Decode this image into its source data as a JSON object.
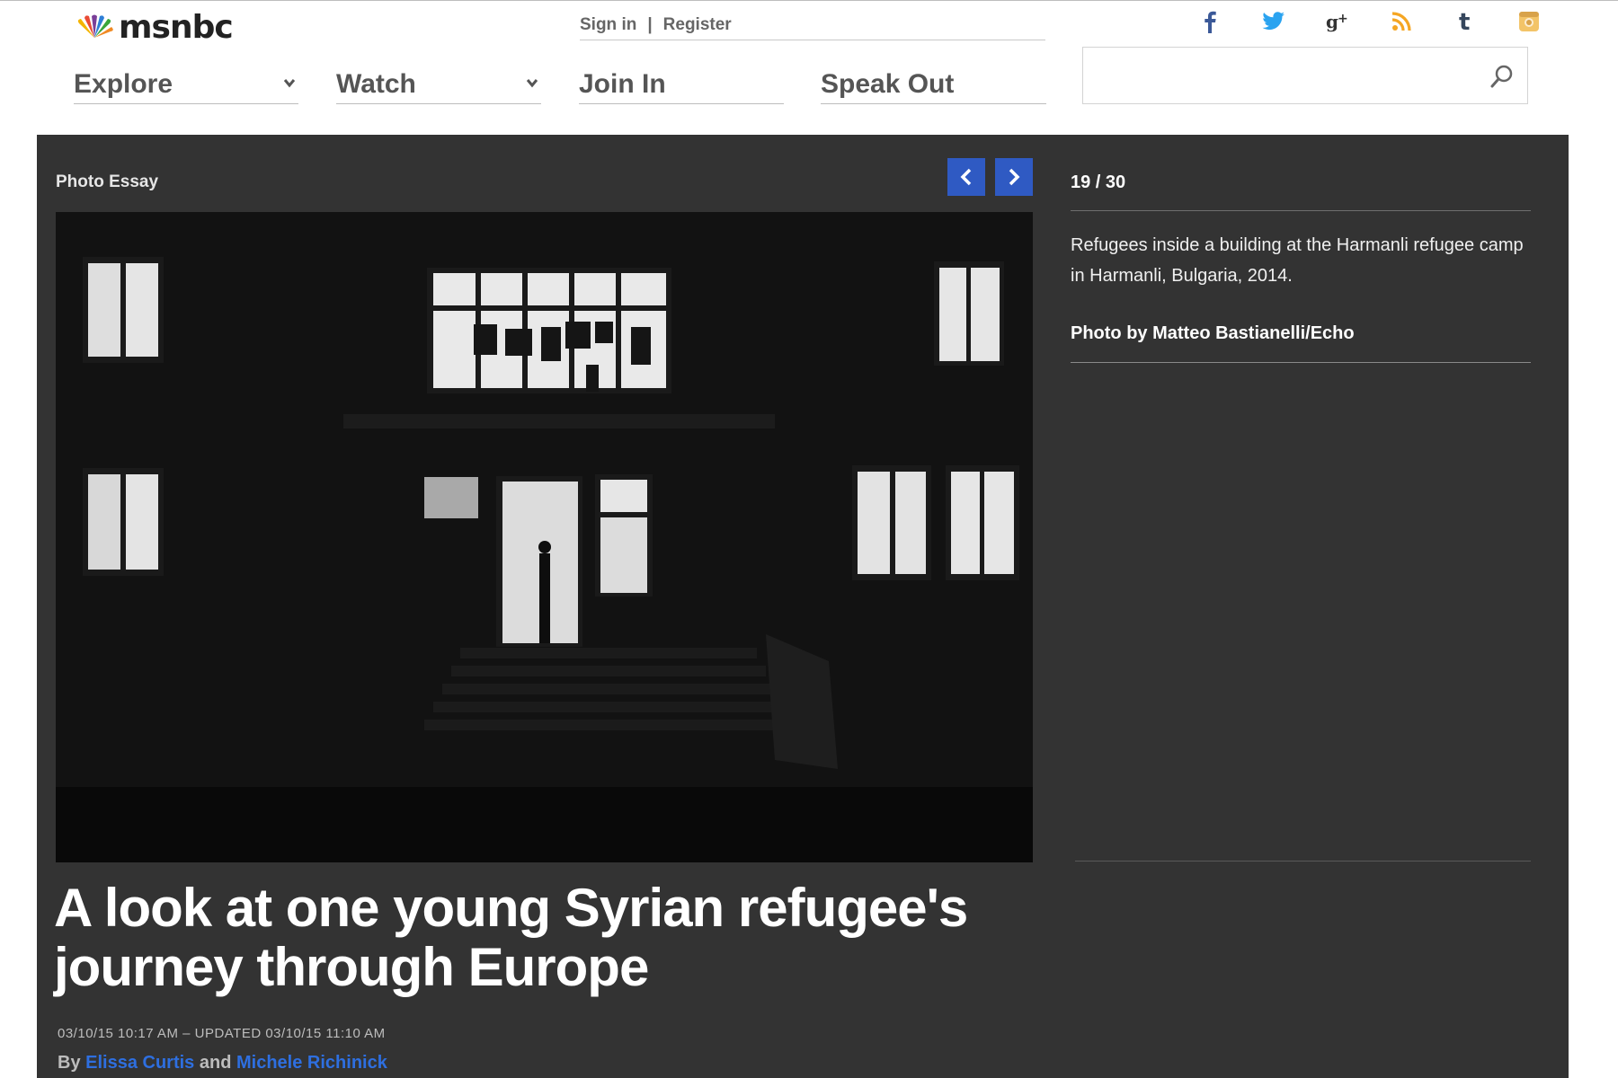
{
  "brand": {
    "name": "msnbc"
  },
  "account": {
    "sign_in": "Sign in",
    "separator": "|",
    "register": "Register"
  },
  "social": [
    {
      "icon": "facebook-icon",
      "glyph": "f",
      "color": "#3b5998"
    },
    {
      "icon": "twitter-icon",
      "glyph": "t",
      "color": "#2aa3f0"
    },
    {
      "icon": "google-plus-icon",
      "glyph": "g+",
      "color": "#333333"
    },
    {
      "icon": "rss-icon",
      "glyph": "rss",
      "color": "#f5a623"
    },
    {
      "icon": "tumblr-icon",
      "glyph": "t",
      "color": "#35465c"
    },
    {
      "icon": "instagram-icon",
      "glyph": "ig",
      "color": "#f3c468"
    }
  ],
  "nav": {
    "explore": "Explore",
    "watch": "Watch",
    "join_in": "Join In",
    "speak_out": "Speak Out"
  },
  "search": {
    "placeholder": "",
    "value": ""
  },
  "gallery": {
    "section_label": "Photo Essay",
    "counter": "19 / 30",
    "caption": "Refugees inside a building at the Harmanli refugee camp in Harmanli, Bulgaria, 2014.",
    "credit": "Photo by Matteo Bastianelli/Echo"
  },
  "article": {
    "headline": "A look at one young Syrian refugee's journey through Europe",
    "dateline": "03/10/15 10:17 AM – UPDATED 03/10/15 11:10 AM",
    "byline_prefix": "By",
    "author1": "Elissa Curtis",
    "and": "and",
    "author2": "Michele Richinick"
  },
  "colors": {
    "accent": "#2f5ac3",
    "panel": "#333333",
    "link": "#2e6fe0"
  }
}
